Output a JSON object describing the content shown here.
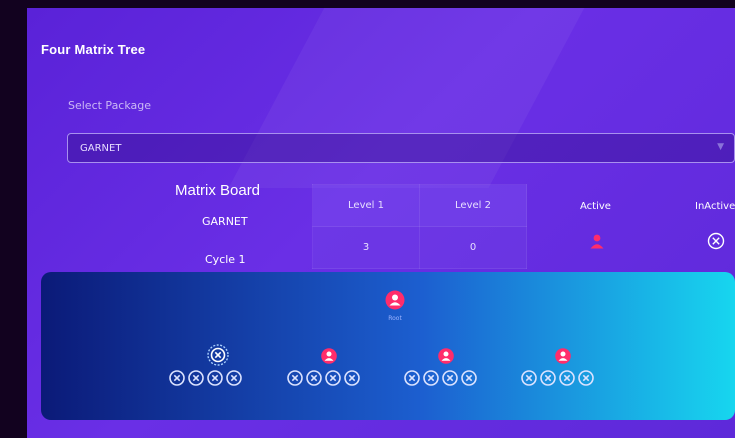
{
  "header": {
    "title": "Four Matrix Tree"
  },
  "package": {
    "label": "Select Package",
    "selected": "GARNET"
  },
  "matrix": {
    "title": "Matrix Board",
    "package_name": "GARNET",
    "cycle": "Cycle 1",
    "levels": {
      "headers": [
        "Level 1",
        "Level 2"
      ],
      "values": [
        "3",
        "0"
      ]
    },
    "active_label": "Active",
    "inactive_label": "InActive"
  },
  "tree": {
    "root_label": "Root",
    "branches": [
      {
        "status": "inactive",
        "slots": 4
      },
      {
        "status": "active",
        "slots": 4
      },
      {
        "status": "active",
        "slots": 4
      },
      {
        "status": "active",
        "slots": 4
      }
    ]
  },
  "colors": {
    "active": "#ff2c6b",
    "inactive": "#dce3ff",
    "panel": "#5e29d9"
  }
}
